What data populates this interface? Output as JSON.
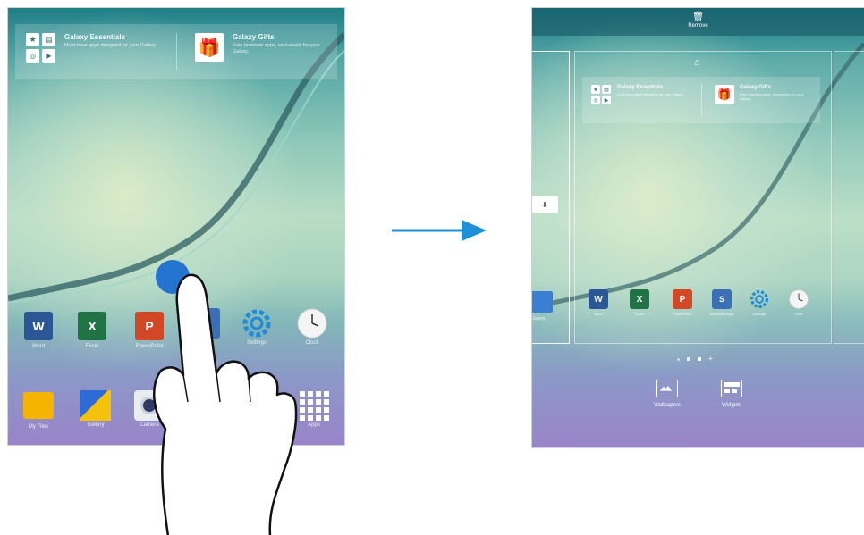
{
  "left_screen": {
    "banner": {
      "essentials": {
        "title": "Galaxy Essentials",
        "desc": "Must-have apps designed for your Galaxy."
      },
      "gifts": {
        "title": "Galaxy Gifts",
        "desc": "Free premium apps, exclusively for your Galaxy."
      }
    },
    "apps_row": [
      {
        "label": "Word",
        "letter": "W",
        "color": "#2b5797"
      },
      {
        "label": "Excel",
        "letter": "X",
        "color": "#217346"
      },
      {
        "label": "PowerPoint",
        "letter": "P",
        "color": "#d24726"
      },
      {
        "label": "",
        "letter": "S",
        "color": "#3b6fb6"
      },
      {
        "label": "Settings",
        "letter": "",
        "color": "#1f8dd6"
      },
      {
        "label": "Clock",
        "letter": "",
        "color": "#ffffff"
      }
    ],
    "dock": [
      {
        "label": "My Files"
      },
      {
        "label": "Gallery"
      },
      {
        "label": "Camera"
      },
      {
        "label": "Apps"
      }
    ]
  },
  "right_screen": {
    "remove_label": "Remove",
    "banner": {
      "essentials": {
        "title": "Galaxy Essentials",
        "desc": "Must-have apps designed for your Galaxy."
      },
      "gifts": {
        "title": "Galaxy Gifts",
        "desc": "Free premium apps, exclusively for your Galaxy."
      }
    },
    "apps_row": [
      {
        "label": "Word",
        "letter": "W",
        "color": "#2b5797"
      },
      {
        "label": "Excel",
        "letter": "X",
        "color": "#217346"
      },
      {
        "label": "PowerPoint",
        "letter": "P",
        "color": "#d24726"
      },
      {
        "label": "Microsoft Apps",
        "letter": "S",
        "color": "#3b6fb6"
      },
      {
        "label": "Settings",
        "letter": "",
        "color": "#1f8dd6"
      },
      {
        "label": "Clock",
        "letter": "",
        "color": "#ffffff"
      }
    ],
    "left_page_label": "Galaxy",
    "wallpapers_label": "Wallpapers",
    "widgets_label": "Widgets"
  },
  "colors": {
    "arrow": "#1e90d6",
    "touch": "#1a6fd0"
  }
}
